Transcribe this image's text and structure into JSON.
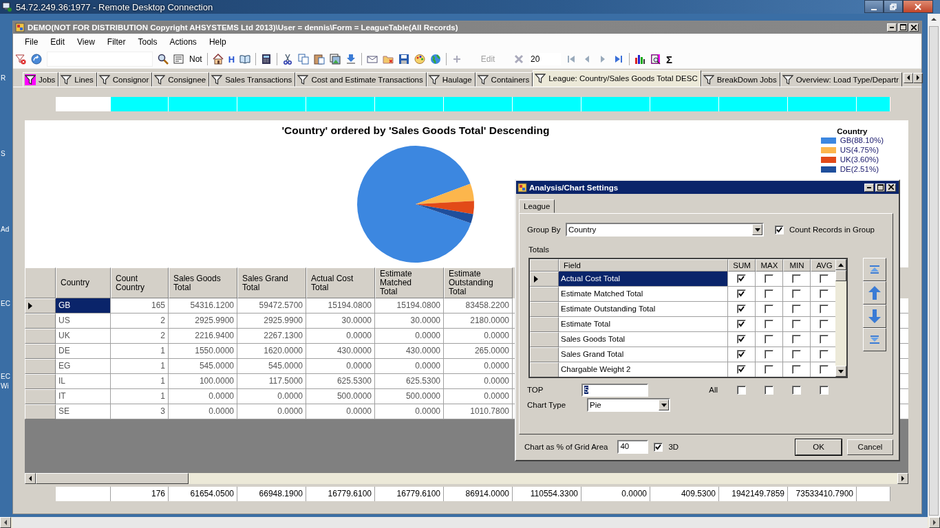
{
  "remote_window": {
    "title": "54.72.249.36:1977 - Remote Desktop Connection"
  },
  "desktop": {
    "labels": [
      "R",
      "S",
      "Ad",
      "EC",
      "EC",
      "Wi"
    ]
  },
  "app_window": {
    "title": "DEMO(NOT FOR DISTRIBUTION Copyright AHSYSTEMS Ltd 2013)\\User = dennis\\Form = LeagueTable(All Records)"
  },
  "menu": [
    "File",
    "Edit",
    "View",
    "Filter",
    "Tools",
    "Actions",
    "Help"
  ],
  "toolbar": {
    "not_label": "Not",
    "h_label": "H",
    "edit": {
      "label": "Edit",
      "disabled": true
    },
    "page_size": "20",
    "sigma": "Σ"
  },
  "tabs": [
    {
      "label": "Jobs",
      "selected": false,
      "filtered": true
    },
    {
      "label": "Lines",
      "selected": false,
      "filtered": false
    },
    {
      "label": "Consignor",
      "selected": false,
      "filtered": false
    },
    {
      "label": "Consignee",
      "selected": false,
      "filtered": false
    },
    {
      "label": "Sales Transactions",
      "selected": false,
      "filtered": false
    },
    {
      "label": "Cost and Estimate Transactions",
      "selected": false,
      "filtered": false
    },
    {
      "label": "Haulage",
      "selected": false,
      "filtered": false
    },
    {
      "label": "Containers",
      "selected": false,
      "filtered": false
    },
    {
      "label": "League: Country/Sales Goods Total DESC",
      "selected": true,
      "filtered": false
    },
    {
      "label": "BreakDown Jobs",
      "selected": false,
      "filtered": false
    },
    {
      "label": "Overview: Load Type/Departr",
      "selected": false,
      "filtered": false
    }
  ],
  "chart": {
    "legend_title": "Country",
    "legend": [
      {
        "color": "#3c87e0"
      },
      {
        "color": "#fcb64c"
      },
      {
        "color": "#e24a18"
      },
      {
        "color": "#1f4f9c"
      }
    ],
    "chart_data": {
      "type": "pie",
      "title": "'Country' ordered by 'Sales Goods Total' Descending",
      "categories": [
        "GB(88.10%)",
        "US(4.75%)",
        "UK(3.60%)",
        "DE(2.51%)"
      ],
      "values": [
        88.1,
        4.75,
        3.6,
        2.51
      ]
    }
  },
  "grid": {
    "columns": [
      "Country",
      "Count Country",
      "Sales Goods Total",
      "Sales Grand Total",
      "Actual Cost Total",
      "Estimate Matched Total",
      "Estimate Outstanding Total"
    ],
    "rows": [
      {
        "selected": true,
        "cells": [
          "GB",
          "165",
          "54316.1200",
          "59472.5700",
          "15194.0800",
          "15194.0800",
          "83458.2200"
        ]
      },
      {
        "selected": false,
        "cells": [
          "US",
          "2",
          "2925.9900",
          "2925.9900",
          "30.0000",
          "30.0000",
          "2180.0000"
        ]
      },
      {
        "selected": false,
        "cells": [
          "UK",
          "2",
          "2216.9400",
          "2267.1300",
          "0.0000",
          "0.0000",
          "0.0000"
        ]
      },
      {
        "selected": false,
        "cells": [
          "DE",
          "1",
          "1550.0000",
          "1620.0000",
          "430.0000",
          "430.0000",
          "265.0000"
        ]
      },
      {
        "selected": false,
        "cells": [
          "EG",
          "1",
          "545.0000",
          "545.0000",
          "0.0000",
          "0.0000",
          "0.0000"
        ]
      },
      {
        "selected": false,
        "cells": [
          "IL",
          "1",
          "100.0000",
          "117.5000",
          "625.5300",
          "625.5300",
          "0.0000"
        ]
      },
      {
        "selected": false,
        "cells": [
          "IT",
          "1",
          "0.0000",
          "0.0000",
          "500.0000",
          "500.0000",
          "0.0000"
        ]
      },
      {
        "selected": false,
        "cells": [
          "SE",
          "3",
          "0.0000",
          "0.0000",
          "0.0000",
          "0.0000",
          "1010.7800"
        ]
      }
    ]
  },
  "totals": [
    "176",
    "61654.0500",
    "66948.1900",
    "16779.6100",
    "16779.6100",
    "86914.0000",
    "110554.3300",
    "0.0000",
    "409.5300",
    "1942149.7859",
    "73533410.7900"
  ],
  "dialog": {
    "title": "Analysis/Chart Settings",
    "tab": {
      "label": "League",
      "selected": true
    },
    "group_by": {
      "label": "Group By",
      "value": "Country"
    },
    "count_records": {
      "label": "Count Records in Group",
      "checked": true
    },
    "totals_label": "Totals",
    "columns": [
      "Field",
      "SUM",
      "MAX",
      "MIN",
      "AVG"
    ],
    "rows": [
      {
        "field": "Actual Cost Total",
        "selected": true,
        "sum": true,
        "max": false,
        "min": false,
        "avg": false
      },
      {
        "field": "Estimate Matched Total",
        "selected": false,
        "sum": true,
        "max": false,
        "min": false,
        "avg": false
      },
      {
        "field": "Estimate Outstanding Total",
        "selected": false,
        "sum": true,
        "max": false,
        "min": false,
        "avg": false
      },
      {
        "field": "Estimate Total",
        "selected": false,
        "sum": true,
        "max": false,
        "min": false,
        "avg": false
      },
      {
        "field": "Sales Goods Total",
        "selected": false,
        "sum": true,
        "max": false,
        "min": false,
        "avg": false
      },
      {
        "field": "Sales Grand Total",
        "selected": false,
        "sum": true,
        "max": false,
        "min": false,
        "avg": false
      },
      {
        "field": "Chargable Weight 2",
        "selected": false,
        "sum": true,
        "max": false,
        "min": false,
        "avg": false
      }
    ],
    "top": {
      "label": "TOP",
      "value": "5"
    },
    "all": {
      "label": "All",
      "sum": false,
      "max": false,
      "min": false,
      "avg": false
    },
    "chart_type": {
      "label": "Chart Type",
      "value": "Pie"
    },
    "chart_pct": {
      "label": "Chart as % of Grid Area",
      "value": "40"
    },
    "three_d": {
      "label": "3D",
      "checked": true
    },
    "buttons": [
      "OK",
      "Cancel"
    ]
  }
}
